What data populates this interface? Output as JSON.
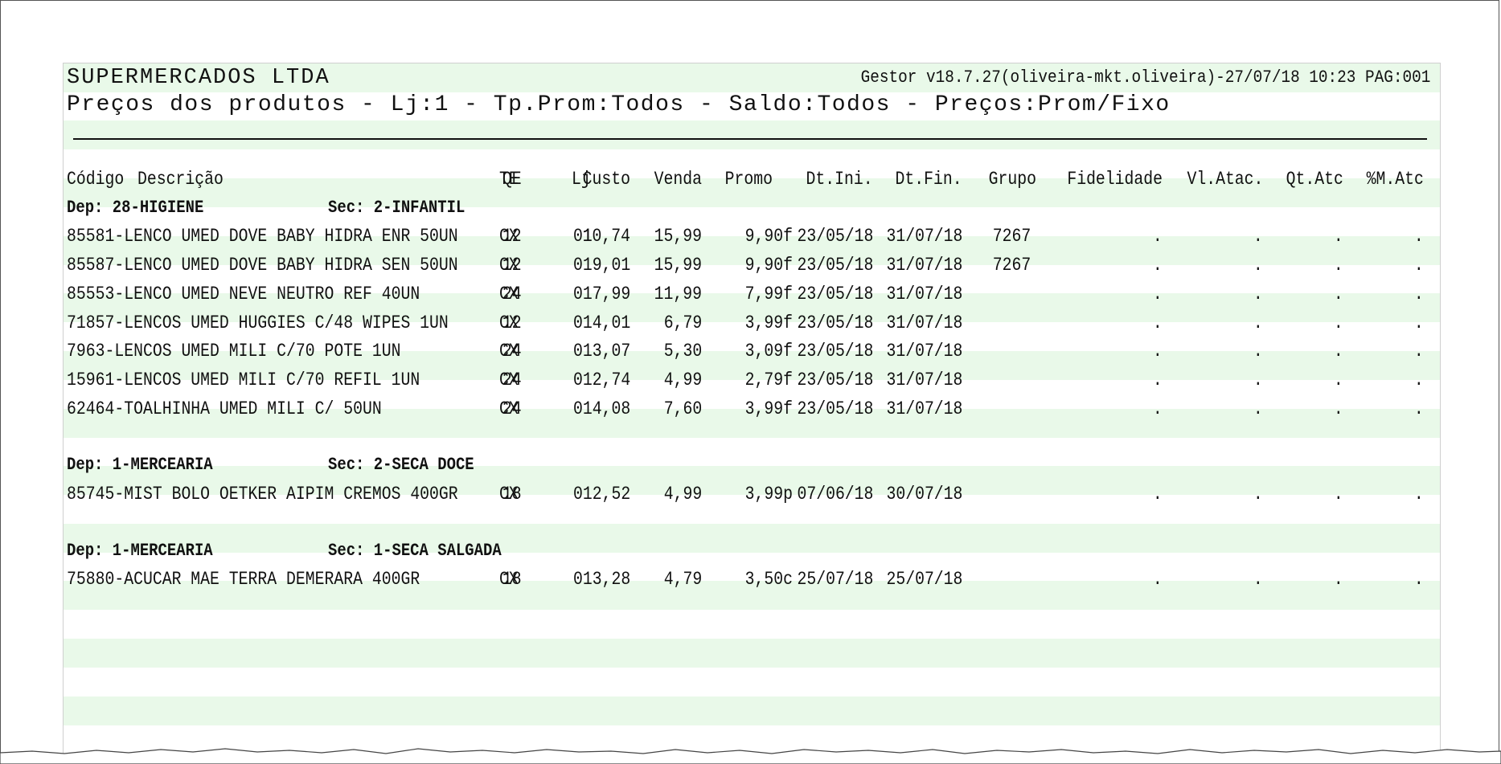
{
  "report": {
    "company": "SUPERMERCADOS LTDA",
    "gestor": "Gestor v18.7.27(oliveira-mkt.oliveira)-27/07/18 10:23 PAG:001",
    "title": "Preços dos produtos - Lj:1 - Tp.Prom:Todos - Saldo:Todos - Preços:Prom/Fixo"
  },
  "columns": {
    "codigo": "Código",
    "descricao": "Descrição",
    "te": "TE",
    "qe": "QE",
    "lj": "Lj",
    "custo": "Custo",
    "venda": "Venda",
    "promo": "Promo",
    "dtini": "Dt.Ini.",
    "dtfin": "Dt.Fin.",
    "grupo": "Grupo",
    "fidelidade": "Fidelidade",
    "vlatac": "Vl.Atac.",
    "qtatc": "Qt.Atc",
    "matc": "%M.Atc"
  },
  "sections": [
    {
      "dep": "Dep: 28-HIGIENE",
      "sec": "Sec: 2-INFANTIL",
      "items": [
        {
          "prod": " 85581-LENCO UMED DOVE BABY HIDRA ENR 50UN",
          "te": "CX",
          "qe": "12",
          "lj": "01",
          "custo": "10,74",
          "venda": "15,99",
          "promo": "9,90f",
          "dtini": "23/05/18",
          "dtfin": "31/07/18",
          "grupo": "7267",
          "fid": ".",
          "vlatac": ".",
          "qtatc": ".",
          "matc": "."
        },
        {
          "prod": " 85587-LENCO UMED DOVE BABY HIDRA SEN 50UN",
          "te": "CX",
          "qe": "12",
          "lj": "01",
          "custo": "9,01",
          "venda": "15,99",
          "promo": "9,90f",
          "dtini": "23/05/18",
          "dtfin": "31/07/18",
          "grupo": "7267",
          "fid": ".",
          "vlatac": ".",
          "qtatc": ".",
          "matc": "."
        },
        {
          "prod": " 85553-LENCO UMED NEVE NEUTRO REF 40UN",
          "te": "CX",
          "qe": "24",
          "lj": "01",
          "custo": "7,99",
          "venda": "11,99",
          "promo": "7,99f",
          "dtini": "23/05/18",
          "dtfin": "31/07/18",
          "grupo": "",
          "fid": ".",
          "vlatac": ".",
          "qtatc": ".",
          "matc": "."
        },
        {
          "prod": " 71857-LENCOS UMED HUGGIES C/48 WIPES 1UN",
          "te": "CX",
          "qe": "12",
          "lj": "01",
          "custo": "4,01",
          "venda": "6,79",
          "promo": "3,99f",
          "dtini": "23/05/18",
          "dtfin": "31/07/18",
          "grupo": "",
          "fid": ".",
          "vlatac": ".",
          "qtatc": ".",
          "matc": "."
        },
        {
          "prod": "  7963-LENCOS UMED MILI C/70 POTE 1UN",
          "te": "CX",
          "qe": "24",
          "lj": "01",
          "custo": "3,07",
          "venda": "5,30",
          "promo": "3,09f",
          "dtini": "23/05/18",
          "dtfin": "31/07/18",
          "grupo": "",
          "fid": ".",
          "vlatac": ".",
          "qtatc": ".",
          "matc": "."
        },
        {
          "prod": " 15961-LENCOS UMED MILI C/70 REFIL 1UN",
          "te": "CX",
          "qe": "24",
          "lj": "01",
          "custo": "2,74",
          "venda": "4,99",
          "promo": "2,79f",
          "dtini": "23/05/18",
          "dtfin": "31/07/18",
          "grupo": "",
          "fid": ".",
          "vlatac": ".",
          "qtatc": ".",
          "matc": "."
        },
        {
          "prod": " 62464-TOALHINHA UMED MILI C/ 50UN",
          "te": "CX",
          "qe": "24",
          "lj": "01",
          "custo": "4,08",
          "venda": "7,60",
          "promo": "3,99f",
          "dtini": "23/05/18",
          "dtfin": "31/07/18",
          "grupo": "",
          "fid": ".",
          "vlatac": ".",
          "qtatc": ".",
          "matc": "."
        }
      ]
    },
    {
      "dep": "Dep: 1-MERCEARIA",
      "sec": "Sec: 2-SECA DOCE",
      "items": [
        {
          "prod": " 85745-MIST BOLO OETKER AIPIM CREMOS 400GR",
          "te": "CX",
          "qe": "18",
          "lj": "01",
          "custo": "2,52",
          "venda": "4,99",
          "promo": "3,99p",
          "dtini": "07/06/18",
          "dtfin": "30/07/18",
          "grupo": "",
          "fid": ".",
          "vlatac": ".",
          "qtatc": ".",
          "matc": "."
        }
      ]
    },
    {
      "dep": "Dep: 1-MERCEARIA",
      "sec": "Sec: 1-SECA SALGADA",
      "items": [
        {
          "prod": " 75880-ACUCAR MAE TERRA DEMERARA 400GR",
          "te": "CX",
          "qe": "18",
          "lj": "01",
          "custo": "3,28",
          "venda": "4,79",
          "promo": "3,50c",
          "dtini": "25/07/18",
          "dtfin": "25/07/18",
          "grupo": "",
          "fid": ".",
          "vlatac": ".",
          "qtatc": ".",
          "matc": "."
        }
      ]
    }
  ]
}
